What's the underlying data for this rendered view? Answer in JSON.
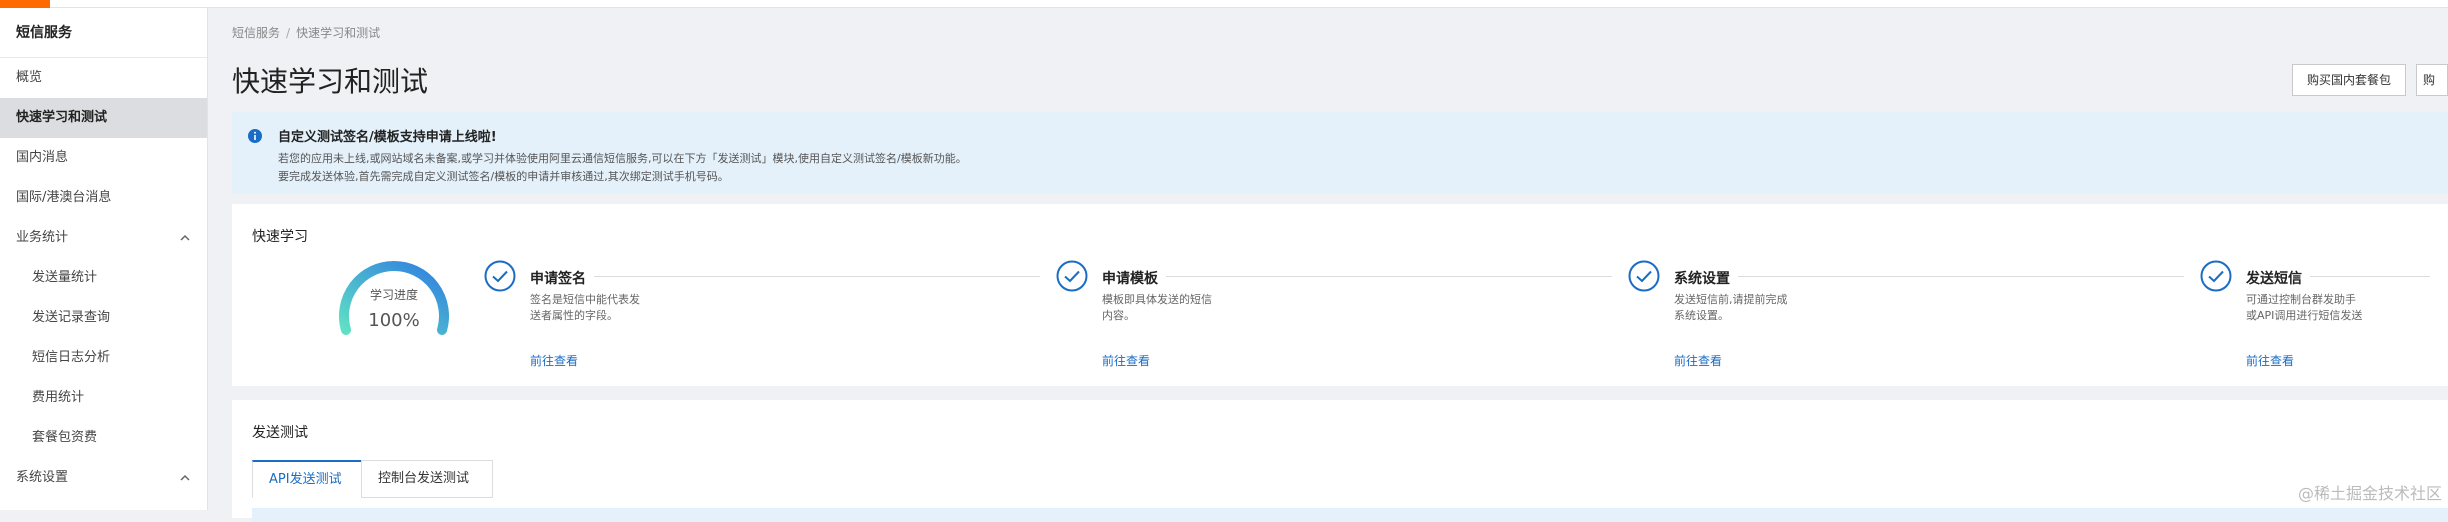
{
  "sidebar": {
    "title": "短信服务",
    "items": [
      {
        "label": "概览"
      },
      {
        "label": "快速学习和测试",
        "active": true
      },
      {
        "label": "国内消息"
      },
      {
        "label": "国际/港澳台消息"
      },
      {
        "label": "业务统计",
        "expanded": true
      },
      {
        "label": "发送量统计"
      },
      {
        "label": "发送记录查询"
      },
      {
        "label": "短信日志分析"
      },
      {
        "label": "费用统计"
      },
      {
        "label": "套餐包资费"
      },
      {
        "label": "系统设置",
        "expanded": true
      }
    ]
  },
  "breadcrumb": {
    "root": "短信服务",
    "separator": "/",
    "current": "快速学习和测试"
  },
  "page_title": "快速学习和测试",
  "top_buttons": {
    "buy_domestic": "购买国内套餐包",
    "buy_cut": "购"
  },
  "notice": {
    "title": "自定义测试签名/模板支持申请上线啦!",
    "line1": "若您的应用未上线,或网站域名未备案,或学习并体验使用阿里云通信短信服务,可以在下方「发送测试」模块,使用自定义测试签名/模板新功能。",
    "line2": "要完成发送体验,首先需完成自定义测试签名/模板的申请并审核通过,其次绑定测试手机号码。",
    "icon": "info-icon",
    "background": "#e4f1fa"
  },
  "quick_learn": {
    "title": "快速学习",
    "gauge": {
      "label": "学习进度",
      "value": "100%",
      "progress": 1.0
    },
    "steps": [
      {
        "title": "申请签名",
        "desc": "签名是短信中能代表发送者属性的字段。",
        "link": "前往查看"
      },
      {
        "title": "申请模板",
        "desc": "模板即具体发送的短信内容。",
        "link": "前往查看"
      },
      {
        "title": "系统设置",
        "desc": "发送短信前,请提前完成系统设置。",
        "link": "前往查看"
      },
      {
        "title": "发送短信",
        "desc": "可通过控制台群发助手或API调用进行短信发送",
        "link": "前往查看"
      }
    ]
  },
  "send_test": {
    "title": "发送测试",
    "tabs": [
      {
        "label": "API发送测试",
        "active": true
      },
      {
        "label": "控制台发送测试"
      }
    ]
  },
  "watermark": "@稀土掘金技术社区",
  "colors": {
    "accent": "#ff6a00",
    "link": "#1a6cc4",
    "check": "#1a6cc4"
  }
}
